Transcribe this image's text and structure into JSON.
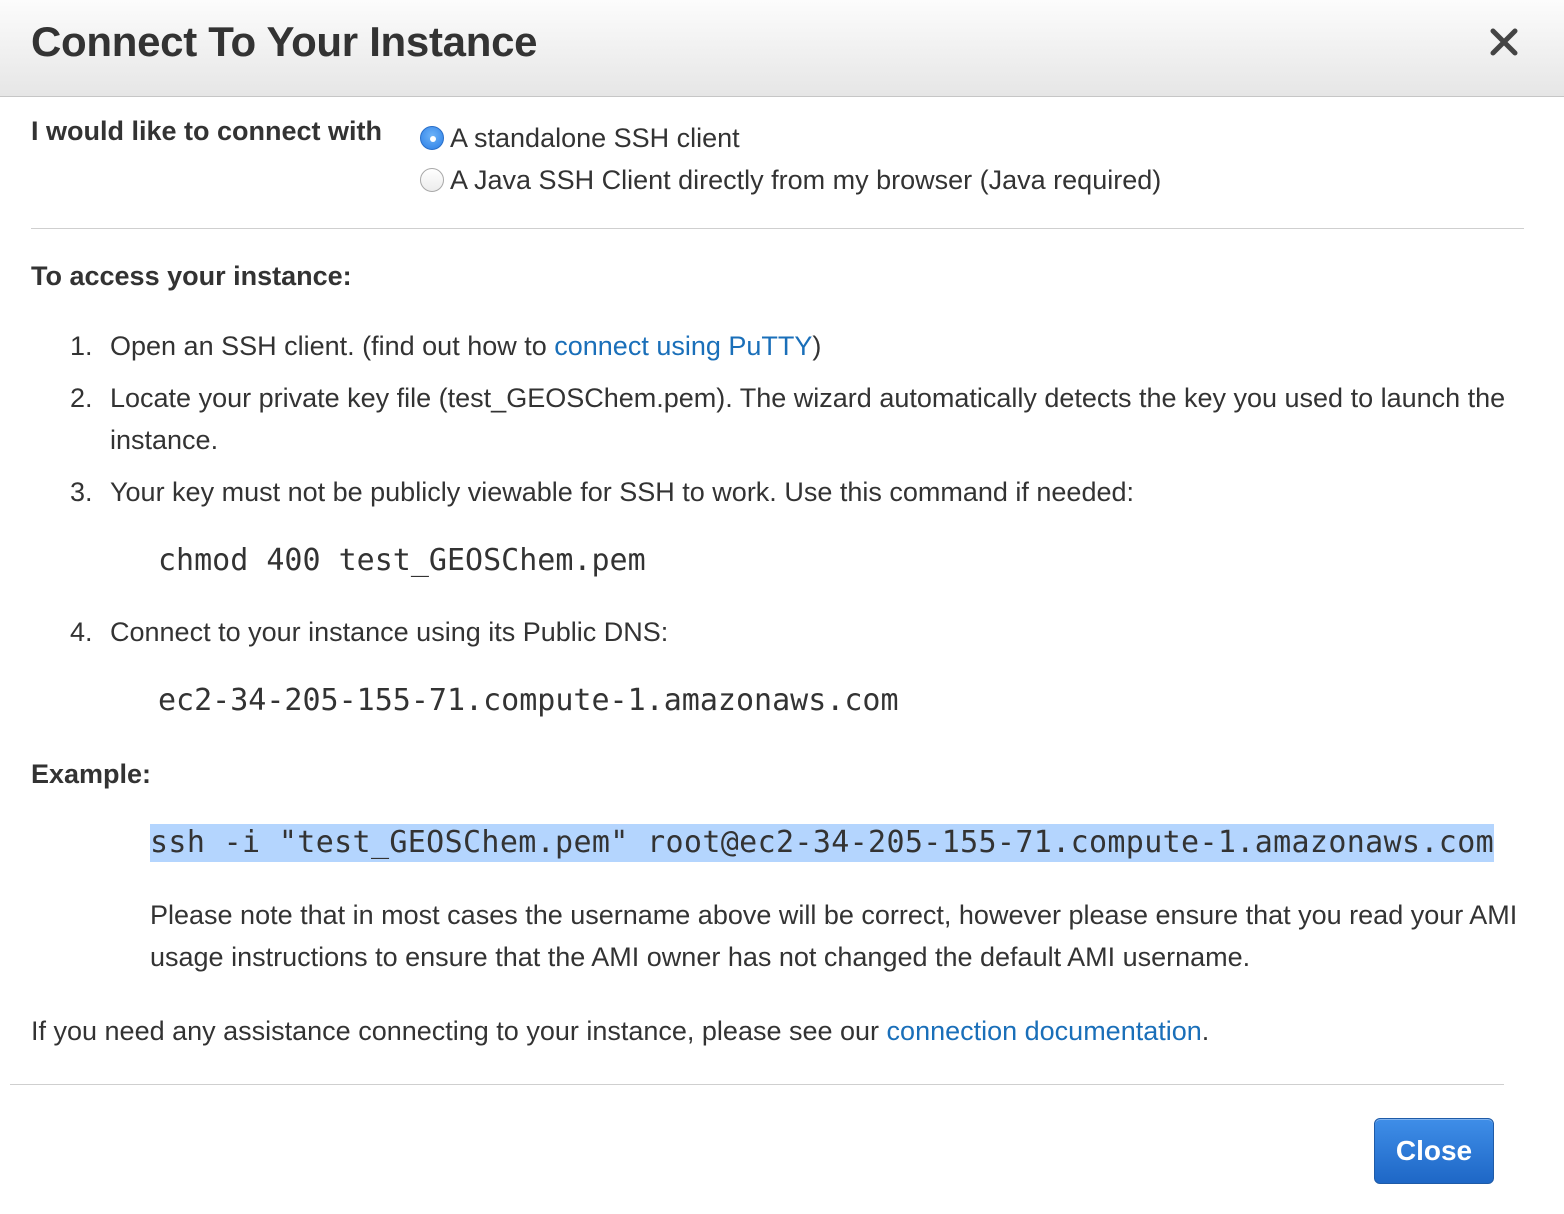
{
  "dialog": {
    "title": "Connect To Your Instance",
    "close_icon": "close-x-icon"
  },
  "connect": {
    "label": "I would like to connect with",
    "options": [
      {
        "label": "A standalone SSH client",
        "selected": true
      },
      {
        "label": "A Java SSH Client directly from my browser (Java required)",
        "selected": false
      }
    ]
  },
  "access": {
    "heading": "To access your instance:",
    "steps": [
      {
        "num": "1.",
        "text_before": "Open an SSH client. (find out how to ",
        "link": "connect using PuTTY",
        "text_after": ")"
      },
      {
        "num": "2.",
        "text": "Locate your private key file (test_GEOSChem.pem). The wizard automatically detects the key you used to launch the instance."
      },
      {
        "num": "3.",
        "text": "Your key must not be publicly viewable for SSH to work. Use this command if needed:",
        "command": "chmod 400 test_GEOSChem.pem"
      },
      {
        "num": "4.",
        "text": "Connect to your instance using its Public DNS:",
        "dns": "ec2-34-205-155-71.compute-1.amazonaws.com"
      }
    ]
  },
  "example": {
    "heading": "Example:",
    "command": "ssh -i \"test_GEOSChem.pem\" root@ec2-34-205-155-71.compute-1.amazonaws.com",
    "note": "Please note that in most cases the username above will be correct, however please ensure that you read your AMI usage instructions to ensure that the AMI owner has not changed the default AMI username."
  },
  "assistance": {
    "text_before": "If you need any assistance connecting to your instance, please see our ",
    "link": "connection documentation",
    "text_after": "."
  },
  "footer": {
    "close_label": "Close"
  },
  "colors": {
    "link": "#1a6fb9",
    "primary_button": "#1e67c6",
    "selection_highlight": "#b4d5fe"
  }
}
